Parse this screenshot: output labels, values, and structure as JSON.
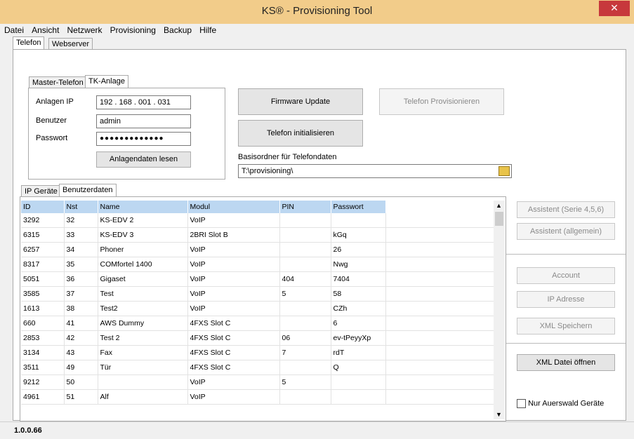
{
  "window": {
    "title": "KS® - Provisioning Tool",
    "close_glyph": "✕"
  },
  "menu": [
    {
      "label": "Datei"
    },
    {
      "label": "Ansicht"
    },
    {
      "label": "Netzwerk"
    },
    {
      "label": "Provisioning"
    },
    {
      "label": "Backup"
    },
    {
      "label": "Hilfe"
    }
  ],
  "main_tabs": [
    "Telefon",
    "Webserver"
  ],
  "inner_tabs": [
    "Master-Telefon",
    "TK-Anlage"
  ],
  "tk": {
    "ip_label": "Anlagen IP",
    "ip_value": "192 .  168 .  001 .  031",
    "user_label": "Benutzer",
    "user_value": "admin",
    "pass_label": "Passwort",
    "pass_value": "●●●●●●●●●●●●●",
    "read_button": "Anlagendaten lesen"
  },
  "actions": {
    "firmware_update": "Firmware Update",
    "provision_phone": "Telefon Provisionieren",
    "init_phone": "Telefon initialisieren",
    "base_folder_label": "Basisordner für Telefondaten",
    "base_folder_value": "T:\\provisioning\\"
  },
  "list_tabs": [
    "IP Geräte",
    "Benutzerdaten"
  ],
  "table": {
    "columns": [
      "ID",
      "Nst",
      "Name",
      "Modul",
      "PIN",
      "Passwort"
    ],
    "rows": [
      [
        "3292",
        "32",
        "KS-EDV 2",
        "VoIP",
        "",
        ""
      ],
      [
        "6315",
        "33",
        "KS-EDV 3",
        "2BRI Slot B",
        "",
        "kGq"
      ],
      [
        "6257",
        "34",
        "Phoner",
        "VoIP",
        "",
        "26"
      ],
      [
        "8317",
        "35",
        "COMfortel 1400",
        "VoIP",
        "",
        "Nwg"
      ],
      [
        "5051",
        "36",
        "Gigaset",
        "VoIP",
        "404",
        "7404"
      ],
      [
        "3585",
        "37",
        "Test",
        "VoIP",
        "5",
        "58"
      ],
      [
        "1613",
        "38",
        "Test2",
        "VoIP",
        "",
        "CZh"
      ],
      [
        "660",
        "41",
        "AWS Dummy",
        "4FXS Slot C",
        "",
        "6"
      ],
      [
        "2853",
        "42",
        "Test 2",
        "4FXS Slot C",
        "06",
        "ev-tPeyyXp"
      ],
      [
        "3134",
        "43",
        "Fax",
        "4FXS Slot C",
        "7",
        "rdT"
      ],
      [
        "3511",
        "49",
        "Tür",
        "4FXS Slot C",
        "",
        "Q"
      ],
      [
        "9212",
        "50",
        "",
        "VoIP",
        "5",
        ""
      ],
      [
        "4961",
        "51",
        "Alf",
        "VoIP",
        "",
        ""
      ]
    ]
  },
  "side_buttons": {
    "assistant_series": "Assistent (Serie 4,5,6)",
    "assistant_general": "Assistent (allgemein)",
    "account": "Account",
    "ip_address": "IP Adresse",
    "xml_save": "XML Speichern",
    "xml_open": "XML Datei öffnen",
    "only_auerswald": "Nur Auerswald Geräte"
  },
  "status": {
    "version": "1.0.0.66"
  },
  "colors": {
    "titlebar": "#f2cc8a",
    "close": "#c7383c",
    "grid_header": "#bcd7f1"
  }
}
